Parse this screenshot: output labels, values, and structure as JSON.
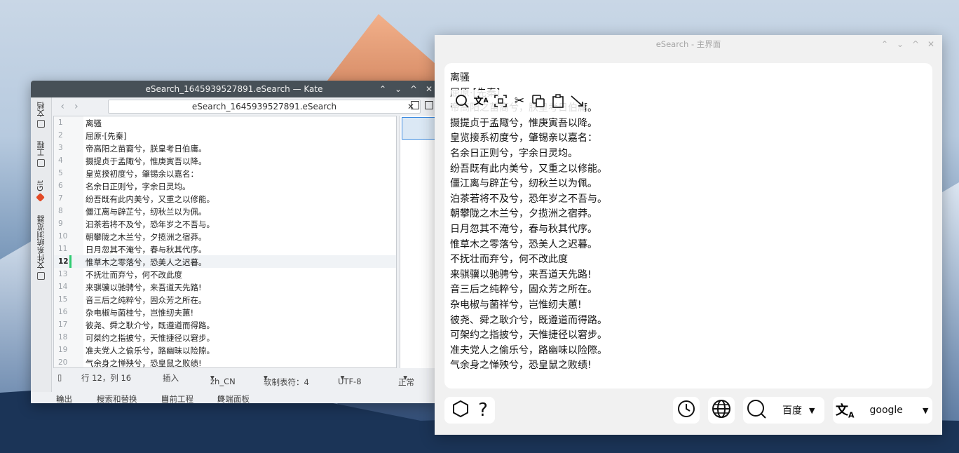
{
  "kate": {
    "title": "eSearch_1645939527891.eSearch — Kate",
    "tab_label": "eSearch_1645939527891.eSearch",
    "side_tabs": [
      "文档",
      "工程",
      "Git",
      "文件系统浏览器"
    ],
    "lines": [
      {
        "n": "1",
        "t": "离骚"
      },
      {
        "n": "2",
        "t": "屈原·[先秦]"
      },
      {
        "n": "3",
        "t": "帝高阳之苗裔兮，朕皇考日伯庸。"
      },
      {
        "n": "4",
        "t": "摄提贞于孟陬兮，惟庚寅吾以降。"
      },
      {
        "n": "5",
        "t": "皇览揆初度兮，肇锡余以嘉名："
      },
      {
        "n": "6",
        "t": "名余日正则兮，字余日灵均。"
      },
      {
        "n": "7",
        "t": "纷吾既有此内美兮，又重之以修能。"
      },
      {
        "n": "8",
        "t": "僵江离与辟芷兮，纫秋兰以为佩。"
      },
      {
        "n": "9",
        "t": "汩茶若将不及兮，恐年岁之不吾与。"
      },
      {
        "n": "10",
        "t": "朝攀陇之木兰兮，夕揽洲之宿莽。"
      },
      {
        "n": "11",
        "t": "日月忽其不淹兮，春与秋其代序。"
      },
      {
        "n": "12",
        "t": "惟草木之零落兮，恐美人之迟暮。"
      },
      {
        "n": "13",
        "t": "不抚壮而弃兮，何不改此度"
      },
      {
        "n": "14",
        "t": "来骐骥以驰骋兮，来吾道天先路!"
      },
      {
        "n": "15",
        "t": "音三后之纯粹兮，固众芳之所在。"
      },
      {
        "n": "16",
        "t": "杂电椒与菌桂兮，岂惟纫夫蕙!"
      },
      {
        "n": "17",
        "t": "彼尧、舜之耿介兮，既遵道而得路。"
      },
      {
        "n": "18",
        "t": "可桀约之指披兮，天惟捷径以窘步。"
      },
      {
        "n": "19",
        "t": "准夫党人之偷乐兮，路幽昧以险隙。"
      },
      {
        "n": "20",
        "t": "气余身之惮殃兮，恐皇鼠之败绩!"
      }
    ],
    "current_line": "12",
    "status": {
      "position": "行 12，列 16",
      "mode": "插入",
      "lang": "zh_CN",
      "tabs": "软制表符：4",
      "encoding": "UTF-8",
      "eol": "正常"
    },
    "bottom": {
      "output": "输出",
      "search": "搜索和替换",
      "project": "当前工程",
      "terminal": "终端面板"
    }
  },
  "esearch": {
    "title": "eSearch - 主界面",
    "lines": [
      "离骚",
      "屈原·[先秦]",
      "帝高阳之苗裔兮，朕皇考日伯庸。",
      "摄提贞于孟陬兮，惟庚寅吾以降。",
      "皇览接系初度兮，肇锡亲以嘉名：",
      "名余日正则兮，字余日灵均。",
      "纷吾既有此内美兮，又重之以修能。",
      "僵江离与辟芷兮，纫秋兰以为佩。",
      "泊茶若将不及兮，恐年岁之不吾与。",
      "朝攀陇之木兰兮，夕揽洲之宿莽。",
      "日月忽其不淹兮，春与秋其代序。",
      "惟草木之零落兮，恐美人之迟暮。",
      "不抚壮而弃兮，何不改此度",
      "来骐骥以驰骋兮，来吾道天先路!",
      "音三后之纯粹兮，固众芳之所在。",
      "杂电椒与菌祥兮，岂惟纫夫蕙!",
      "彼尧、舜之耿介兮，既遵道而得路。",
      "可架约之指披兮，天惟捷径以窘步。",
      "准夫党人之偷乐兮，路幽味以险際。",
      "气余身之惮殃兮，恐皇鼠之败绩!"
    ],
    "search_engine": "百度",
    "translate_engine": "google"
  },
  "icons": [
    "search-icon",
    "translate-icon",
    "scan-icon",
    "cut-icon",
    "copy-icon",
    "paste-icon",
    "wrap-icon",
    "hexagon-icon",
    "help-icon",
    "history-icon",
    "globe-icon"
  ],
  "colors": {
    "kate_titlebar": "#475057",
    "current_line_mark": "#2ecc71",
    "git_icon": "#e24a27"
  }
}
